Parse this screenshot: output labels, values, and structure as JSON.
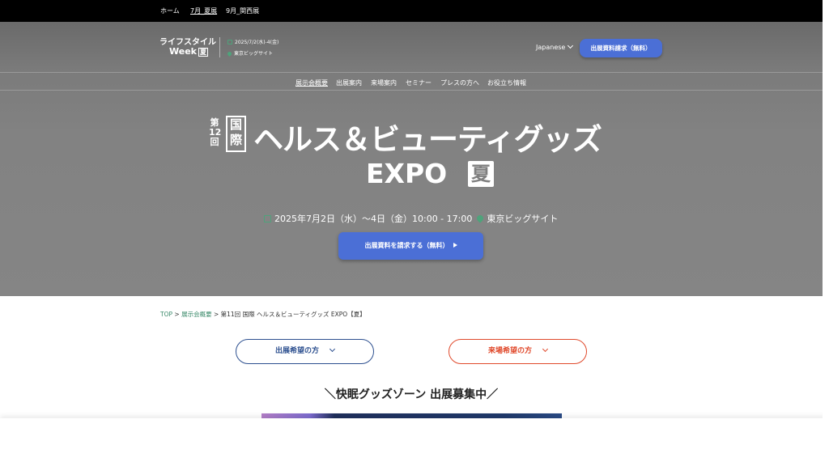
{
  "topbar": {
    "items": [
      "ホーム",
      "7月_夏展",
      "9月_関西展"
    ]
  },
  "header": {
    "logo_line1": "ライフスタイル",
    "logo_line2": "Week",
    "logo_badge": "夏",
    "dates": "2025/7/2(水)-4(金)",
    "venue": "東京ビッグサイト",
    "language": "Japanese",
    "request_button": "出展資料請求（無料）"
  },
  "subnav": {
    "items": [
      "展示会概要",
      "出展案内",
      "来場案内",
      "セミナー",
      "プレスの方へ",
      "お役立ち情報"
    ]
  },
  "hero": {
    "edition_dai": "第",
    "edition_num": "12",
    "edition_kai": "回",
    "kokusai": "国際",
    "title_line1": "ヘルス＆ビューティグッズ",
    "title_line2": "EXPO",
    "title_badge": "夏",
    "date_text": "2025年7月2日（水）〜4日（金）10:00 - 17:00",
    "venue_text": "東京ビッグサイト",
    "cta_label": "出展資料を請求する（無料）"
  },
  "breadcrumb": {
    "top": "TOP",
    "sep": " > ",
    "overview": "展示会概要",
    "current": "第11回 国際 ヘルス＆ビューティグッズ EXPO【夏】"
  },
  "buttons": {
    "exhibitor": "出展希望の方",
    "visitor": "来場希望の方"
  },
  "zone_heading": "＼快眠グッズゾーン 出展募集中／",
  "colors": {
    "accent_blue": "#4b6fd6",
    "accent_green": "#4ea37b",
    "exhibitor_blue": "#2c4f8f",
    "visitor_red": "#e0492b"
  }
}
